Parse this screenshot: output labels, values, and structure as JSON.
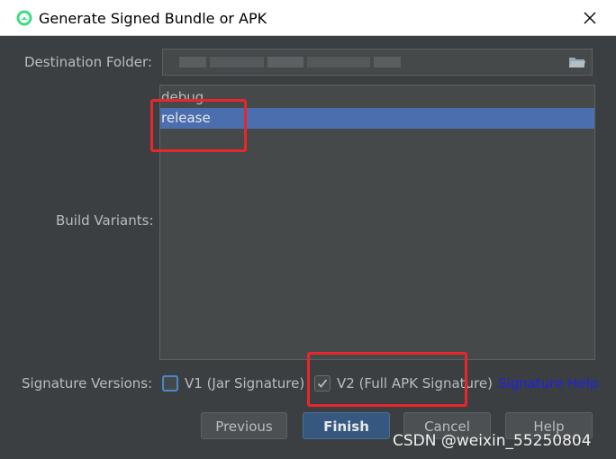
{
  "window": {
    "title": "Generate Signed Bundle or APK"
  },
  "destination": {
    "label": "Destination Folder:",
    "value": ""
  },
  "build_variants": {
    "label": "Build Variants:",
    "items": [
      {
        "label": "debug",
        "selected": false
      },
      {
        "label": "release",
        "selected": true
      }
    ]
  },
  "signature": {
    "label": "Signature Versions:",
    "v1_label": "V1 (Jar Signature)",
    "v1_checked": false,
    "v2_label": "V2 (Full APK Signature)",
    "v2_checked": true,
    "help_label": "Signature Help"
  },
  "buttons": {
    "previous": "Previous",
    "finish": "Finish",
    "cancel": "Cancel",
    "help": "Help"
  },
  "watermark": "CSDN @weixin_55250804",
  "colors": {
    "background": "#3c3f41",
    "selection": "#4b6eaf",
    "annotation_red": "#e8262b",
    "link": "#1e22e8",
    "primary_button": "#365880"
  }
}
